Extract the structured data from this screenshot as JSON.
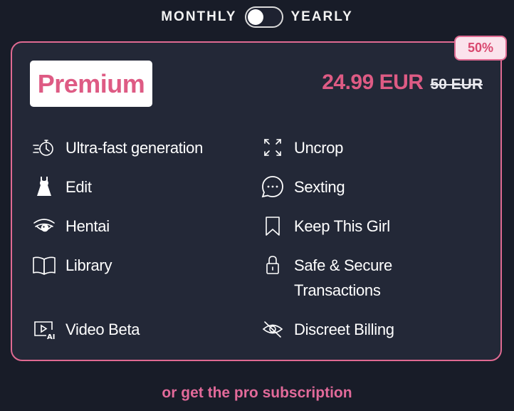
{
  "billing_toggle": {
    "monthly_label": "MONTHLY",
    "yearly_label": "YEARLY",
    "selected": "monthly"
  },
  "plan": {
    "badge": "50%",
    "name": "Premium",
    "price": "24.99 EUR",
    "old_price": "50 EUR"
  },
  "features": [
    {
      "label": "Ultra-fast generation",
      "icon": "stopwatch-icon"
    },
    {
      "label": "Uncrop",
      "icon": "expand-icon"
    },
    {
      "label": "Edit",
      "icon": "dress-icon"
    },
    {
      "label": "Sexting",
      "icon": "chat-bubble-icon"
    },
    {
      "label": "Hentai",
      "icon": "eye-icon"
    },
    {
      "label": "Keep This Girl",
      "icon": "bookmark-icon"
    },
    {
      "label": "Library",
      "icon": "book-icon"
    },
    {
      "label": "Safe & Secure",
      "label2": "Transactions",
      "icon": "lock-icon"
    },
    {
      "label": "Video Beta",
      "icon": "ai-video-icon"
    },
    {
      "label": "Discreet Billing",
      "icon": "eye-off-icon"
    }
  ],
  "footer": {
    "pro_link": "or get the pro subscription"
  },
  "colors": {
    "accent": "#e06a92",
    "background": "#181c28",
    "card": "#232837"
  }
}
